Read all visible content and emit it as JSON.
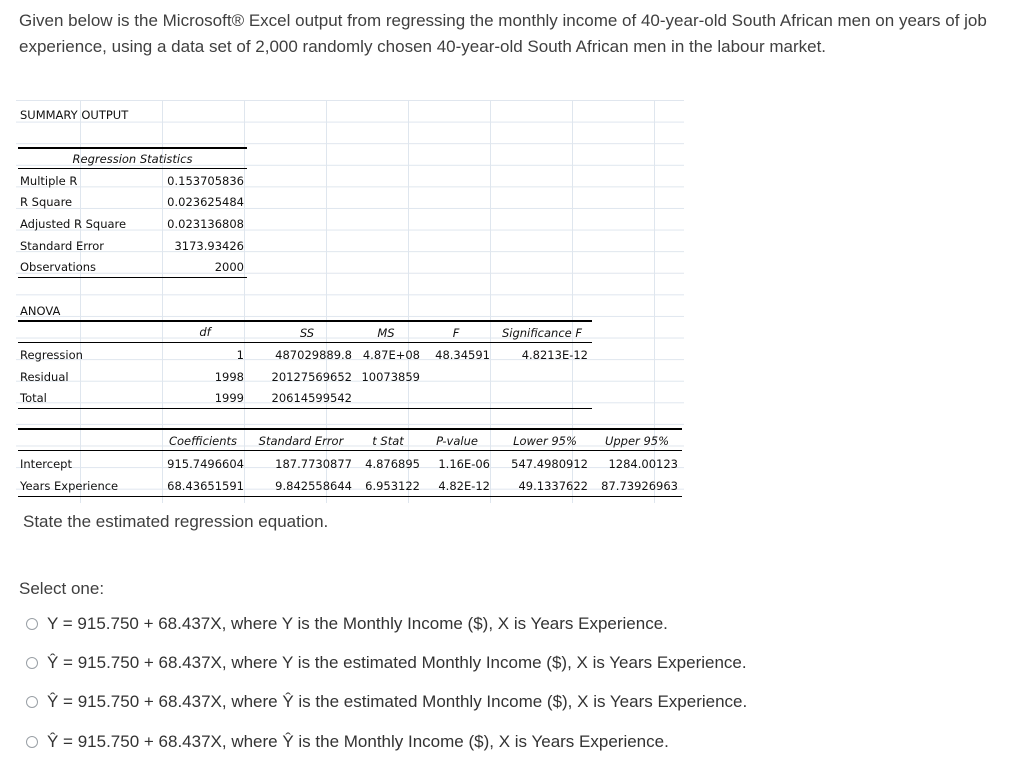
{
  "intro": "Given below is the Microsoft® Excel output from regressing the monthly income of 40-year-old South African men on years of job experience, using a data set of 2,000 randomly chosen 40-year-old South African men in the labour market.",
  "excel": {
    "summary_title": "SUMMARY OUTPUT",
    "regstats_title": "Regression Statistics",
    "regstats": [
      {
        "label": "Multiple R",
        "value": "0.153705836"
      },
      {
        "label": "R Square",
        "value": "0.023625484"
      },
      {
        "label": "Adjusted R Square",
        "value": "0.023136808"
      },
      {
        "label": "Standard Error",
        "value": "3173.93426"
      },
      {
        "label": "Observations",
        "value": "2000"
      }
    ],
    "anova_title": "ANOVA",
    "anova_headers": [
      "df",
      "SS",
      "MS",
      "F",
      "Significance F"
    ],
    "anova_rows": [
      {
        "label": "Regression",
        "df": "1",
        "ss": "487029889.8",
        "ms": "4.87E+08",
        "f": "48.34591",
        "sigf": "4.8213E-12"
      },
      {
        "label": "Residual",
        "df": "1998",
        "ss": "20127569652",
        "ms": "10073859",
        "f": "",
        "sigf": ""
      },
      {
        "label": "Total",
        "df": "1999",
        "ss": "20614599542",
        "ms": "",
        "f": "",
        "sigf": ""
      }
    ],
    "coef_headers": [
      "Coefficients",
      "Standard Error",
      "t Stat",
      "P-value",
      "Lower 95%",
      "Upper 95%"
    ],
    "coef_rows": [
      {
        "label": "Intercept",
        "coef": "915.7496604",
        "se": "187.7730877",
        "t": "4.876895",
        "p": "1.16E-06",
        "lower": "547.4980912",
        "upper": "1284.00123"
      },
      {
        "label": "Years Experience",
        "coef": "68.43651591",
        "se": "9.842558644",
        "t": "6.953122",
        "p": "4.82E-12",
        "lower": "49.1337622",
        "upper": "87.73926963"
      }
    ]
  },
  "question": "State the estimated regression equation.",
  "select_label": "Select one:",
  "options": [
    "Y = 915.750 + 68.437X, where Y is the Monthly Income ($), X is Years Experience.",
    "Ŷ = 915.750 + 68.437X, where Y is the estimated Monthly Income ($), X is Years Experience.",
    "Ŷ = 915.750 + 68.437X, where Ŷ is the estimated Monthly Income ($), X is Years Experience.",
    "Ŷ = 915.750 + 68.437X, where Ŷ is the Monthly Income ($), X is Years Experience."
  ]
}
